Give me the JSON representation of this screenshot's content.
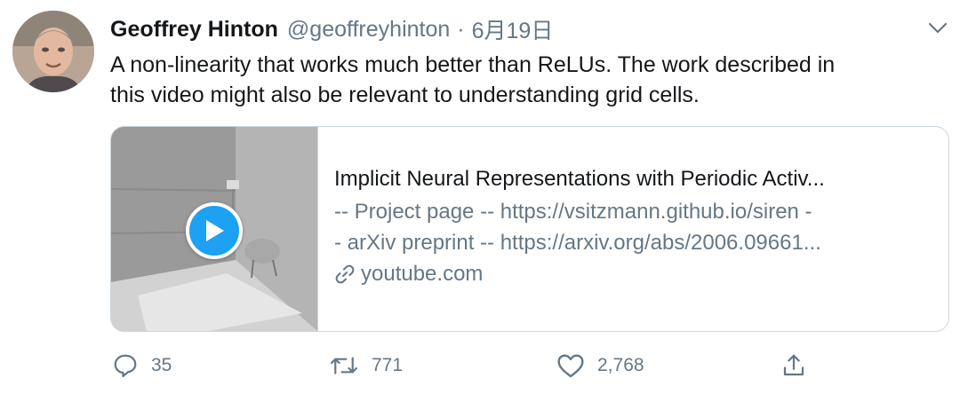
{
  "tweet": {
    "author_name": "Geoffrey Hinton",
    "handle": "@geoffreyhinton",
    "separator": "·",
    "date": "6月19日",
    "text_line1": "A non-linearity that works much better than ReLUs. The work described in",
    "text_line2": "this video might also be relevant to understanding grid cells."
  },
  "card": {
    "title": "Implicit Neural Representations with Periodic Activ...",
    "desc_line1": "-- Project page -- https://vsitzmann.github.io/siren -",
    "desc_line2": "- arXiv preprint -- https://arxiv.org/abs/2006.09661...",
    "domain": "youtube.com"
  },
  "actions": {
    "reply_count": "35",
    "retweet_count": "771",
    "like_count": "2,768"
  },
  "colors": {
    "accent": "#1da1f2",
    "secondary_text": "#657786",
    "border": "#ccd6dd"
  },
  "icons": [
    "chevron-down-icon",
    "play-icon",
    "link-icon",
    "reply-icon",
    "retweet-icon",
    "like-icon",
    "share-icon"
  ]
}
